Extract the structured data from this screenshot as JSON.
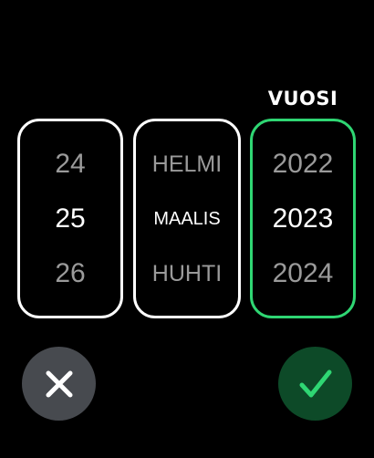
{
  "picker": {
    "heading": "VUOSI",
    "day": {
      "items": [
        "24",
        "25",
        "26"
      ],
      "selected": "25"
    },
    "month": {
      "items": [
        "HELMI",
        "MAALIS",
        "HUHTI"
      ],
      "selected": "MAALIS"
    },
    "year": {
      "items": [
        "2022",
        "2023",
        "2024"
      ],
      "selected": "2023"
    },
    "active_column": "year"
  },
  "actions": {
    "cancel_icon": "x-icon",
    "confirm_icon": "checkmark-icon"
  },
  "colors": {
    "background": "#000000",
    "accent": "#2fd673",
    "confirm_bg": "#0d4a28",
    "cancel_bg": "#474a4f",
    "dim_text": "#9a9a9a"
  }
}
